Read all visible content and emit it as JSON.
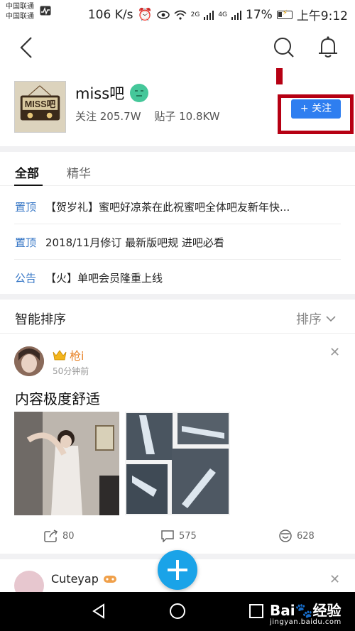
{
  "status_bar": {
    "carrier_1": "中国联通",
    "carrier_2": "中国联通",
    "speed": "106 K/s",
    "net_2g": "2G",
    "net_4g": "4G",
    "battery": "17%",
    "time": "上午9:12"
  },
  "forum": {
    "name": "miss吧",
    "followers_label": "关注 205.7W",
    "posts_label": "贴子 10.8KW",
    "follow_button": "+ 关注",
    "avatar_text": "MISS吧"
  },
  "tabs": [
    "全部",
    "精华"
  ],
  "pinned": [
    {
      "tag": "置顶",
      "text": "【贺岁礼】蜜吧好凉茶在此祝蜜吧全体吧友新年快..."
    },
    {
      "tag": "置顶",
      "text": "2018/11月修订 最新版吧规 进吧必看"
    },
    {
      "tag": "公告",
      "text": "【火】单吧会员隆重上线"
    }
  ],
  "sort_bar": {
    "title": "智能排序",
    "toggle": "排序"
  },
  "post": {
    "user": "枪i",
    "time": "50分钟前",
    "title": "内容极度舒适",
    "shares": "80",
    "comments": "575",
    "likes": "628"
  },
  "post2": {
    "user": "Cuteyap"
  },
  "watermark": {
    "brand": "Bai",
    "brand_cn": "经验",
    "url": "jingyan.baidu.com"
  },
  "colors": {
    "accent": "#2e7ef0",
    "highlight_frame": "#b60013",
    "pinned_tag": "#3475c5",
    "fab": "#1aa3e8",
    "username": "#e8852c"
  }
}
